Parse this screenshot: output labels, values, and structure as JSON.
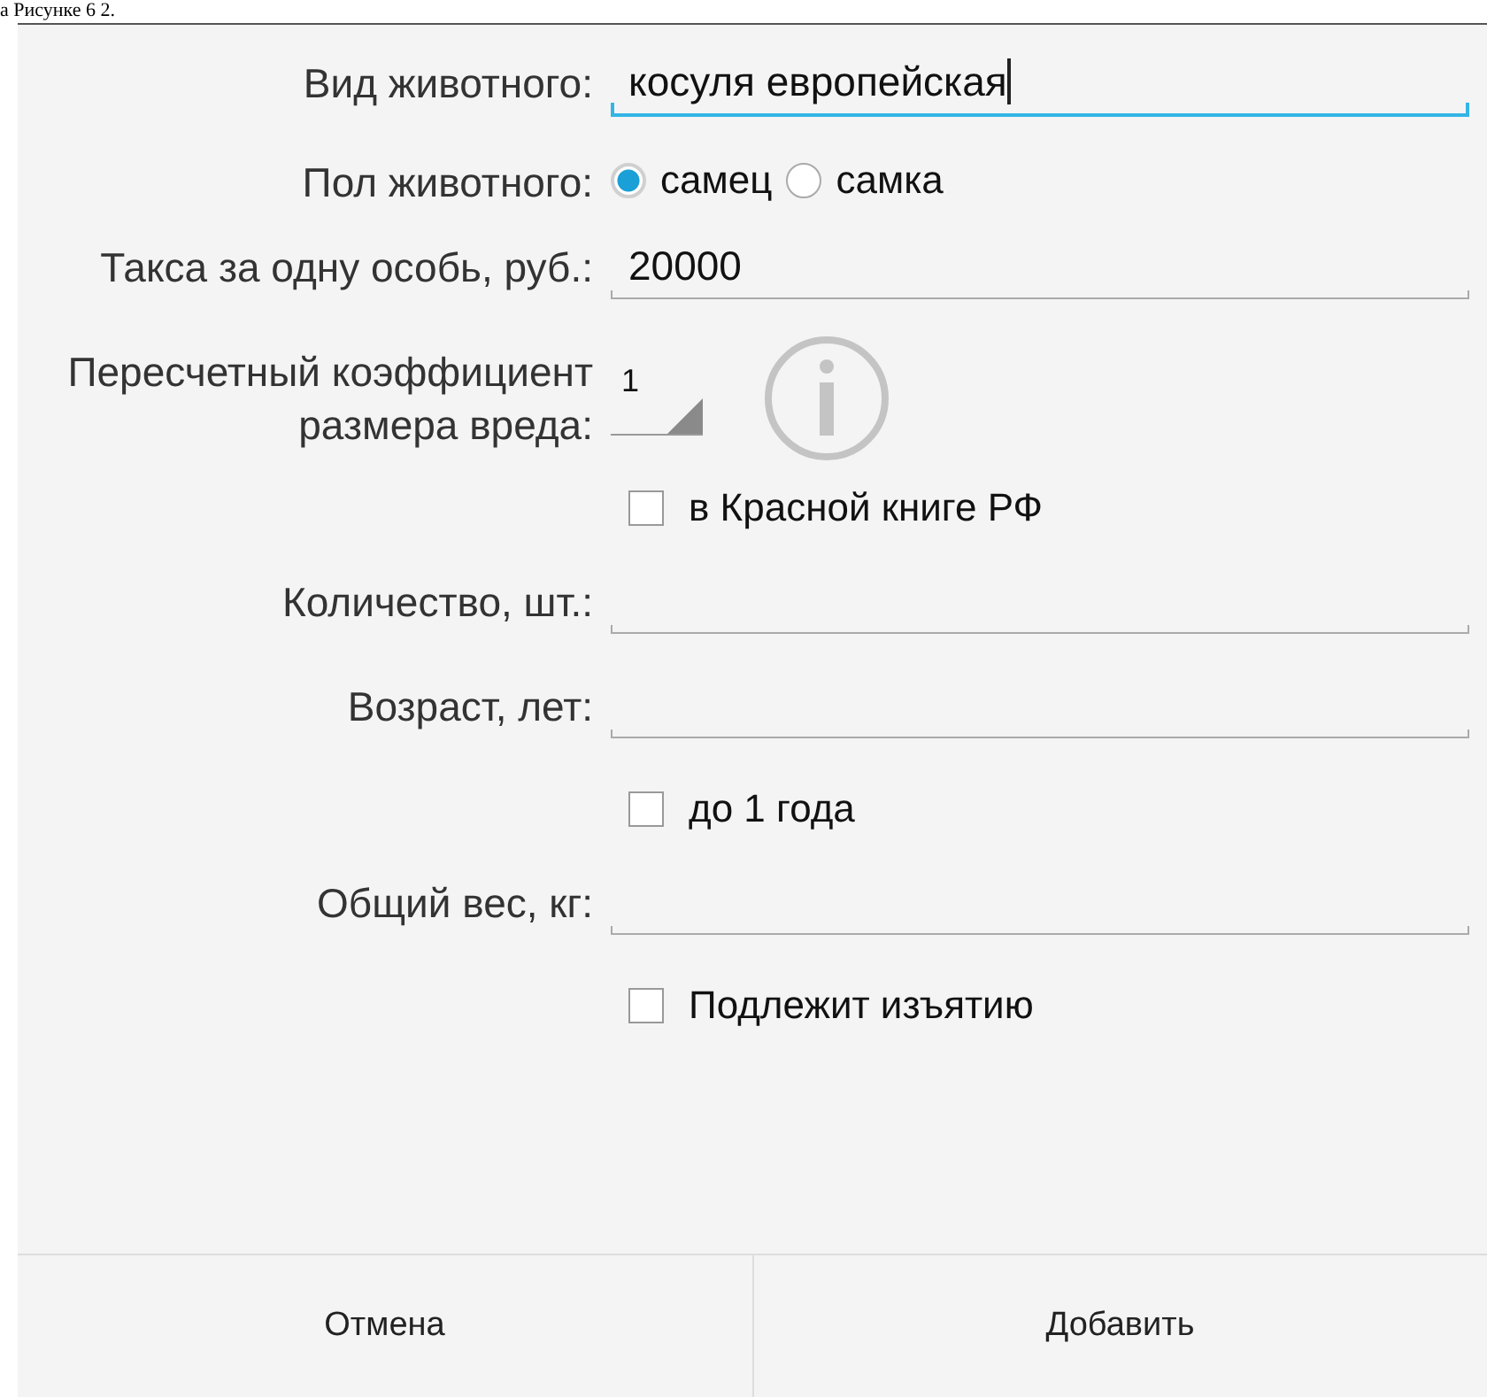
{
  "document_caption": "а Рисунке 6 2.",
  "form": {
    "rows": [
      {
        "kind": "field",
        "label": "Вид животного:",
        "value": "косуля европейская",
        "focused": true
      },
      {
        "kind": "radio",
        "label": "Пол животного:",
        "options": [
          {
            "label": "самец",
            "selected": true
          },
          {
            "label": "самка",
            "selected": false
          }
        ]
      },
      {
        "kind": "field",
        "label": "Такса за одну особь, руб.:",
        "value": "20000",
        "focused": false
      },
      {
        "kind": "spinner",
        "label": "Пересчетный коэффициент размера вреда:",
        "value": "1"
      },
      {
        "kind": "checkbox",
        "label": "в Красной книге РФ",
        "checked": false
      },
      {
        "kind": "field",
        "label": "Количество, шт.:",
        "focused": false
      },
      {
        "kind": "field",
        "label": "Возраст, лет:",
        "focused": false
      },
      {
        "kind": "checkbox",
        "label": "до 1 года",
        "checked": false
      },
      {
        "kind": "field",
        "label": "Общий вес, кг:",
        "focused": false
      },
      {
        "kind": "checkbox",
        "label": "Подлежит изъятию",
        "checked": false
      }
    ]
  },
  "buttons": [
    "Отмена",
    "Добавить"
  ]
}
